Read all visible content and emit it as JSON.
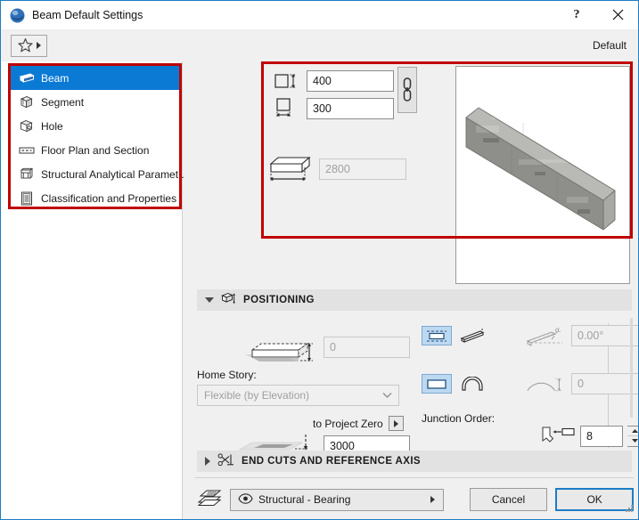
{
  "window": {
    "title": "Beam Default Settings",
    "app_icon": "archicad-orb-icon",
    "help_label": "?",
    "close_label": "✕"
  },
  "toolbar": {
    "favorites_icon": "star-icon",
    "favorites_dropdown_icon": "caret-right-icon",
    "default_label": "Default"
  },
  "sidebar": {
    "items": [
      {
        "label": "Beam",
        "icon": "beam-icon",
        "selected": true
      },
      {
        "label": "Segment",
        "icon": "segment-cube-icon",
        "selected": false
      },
      {
        "label": "Hole",
        "icon": "hole-cube-icon",
        "selected": false
      },
      {
        "label": "Floor Plan and Section",
        "icon": "floor-plan-section-icon",
        "selected": false
      },
      {
        "label": "Structural Analytical Paramet...",
        "icon": "structural-analytical-icon",
        "selected": false
      },
      {
        "label": "Classification and Properties",
        "icon": "classification-properties-icon",
        "selected": false
      }
    ]
  },
  "dimensions": {
    "height": {
      "icon": "beam-height-icon",
      "value": "400",
      "enabled": true
    },
    "width": {
      "icon": "beam-width-icon",
      "value": "300",
      "enabled": true
    },
    "link_icon": "chain-link-icon",
    "length": {
      "icon": "beam-length-icon",
      "value": "2800",
      "enabled": false
    }
  },
  "preview": {
    "icon": "beam-3d-preview"
  },
  "positioning": {
    "header": "POSITIONING",
    "header_icon": "positioning-icon",
    "expanded": true,
    "offset": {
      "icon": "beam-elevation-icon",
      "value": "0",
      "enabled": false
    },
    "home_story_label": "Home Story:",
    "home_story_value": "Flexible (by Elevation)",
    "to_project_zero_label": "to Project Zero",
    "to_project_zero_arrow_icon": "caret-right-icon",
    "project_zero": {
      "icon": "project-zero-icon",
      "value": "3000",
      "enabled": true
    },
    "slant_straight_icon": "beam-horizontal-icon",
    "slant_angled_icon": "beam-slanted-icon",
    "slant_angle_icon": "slant-angle-icon",
    "slant_angle_value": "0.00°",
    "profile_straight_icon": "beam-straight-profile-icon",
    "profile_curved_icon": "beam-curved-profile-icon",
    "curve_height_icon": "curve-height-icon",
    "curve_height_value": "0",
    "junction_order_label": "Junction Order:",
    "junction_icon": "junction-order-icon",
    "junction_value": "8",
    "spin_up_icon": "caret-up-icon",
    "spin_down_icon": "caret-down-icon"
  },
  "end_cuts": {
    "header": "END CUTS AND REFERENCE AXIS",
    "header_icon": "end-cuts-icon",
    "expanded": false
  },
  "footer": {
    "layers_icon": "layers-icon",
    "material_eye_icon": "eye-icon",
    "material_value": "Structural - Bearing",
    "material_arrow_icon": "caret-right-icon",
    "cancel_label": "Cancel",
    "ok_label": "OK",
    "resize_grip_icon": "resize-grip-icon"
  },
  "colors": {
    "accent": "#0b7ad5",
    "highlight_box": "#c00000",
    "toggle_active": "#bcd9f2",
    "window_border": "#1e7cc4"
  }
}
